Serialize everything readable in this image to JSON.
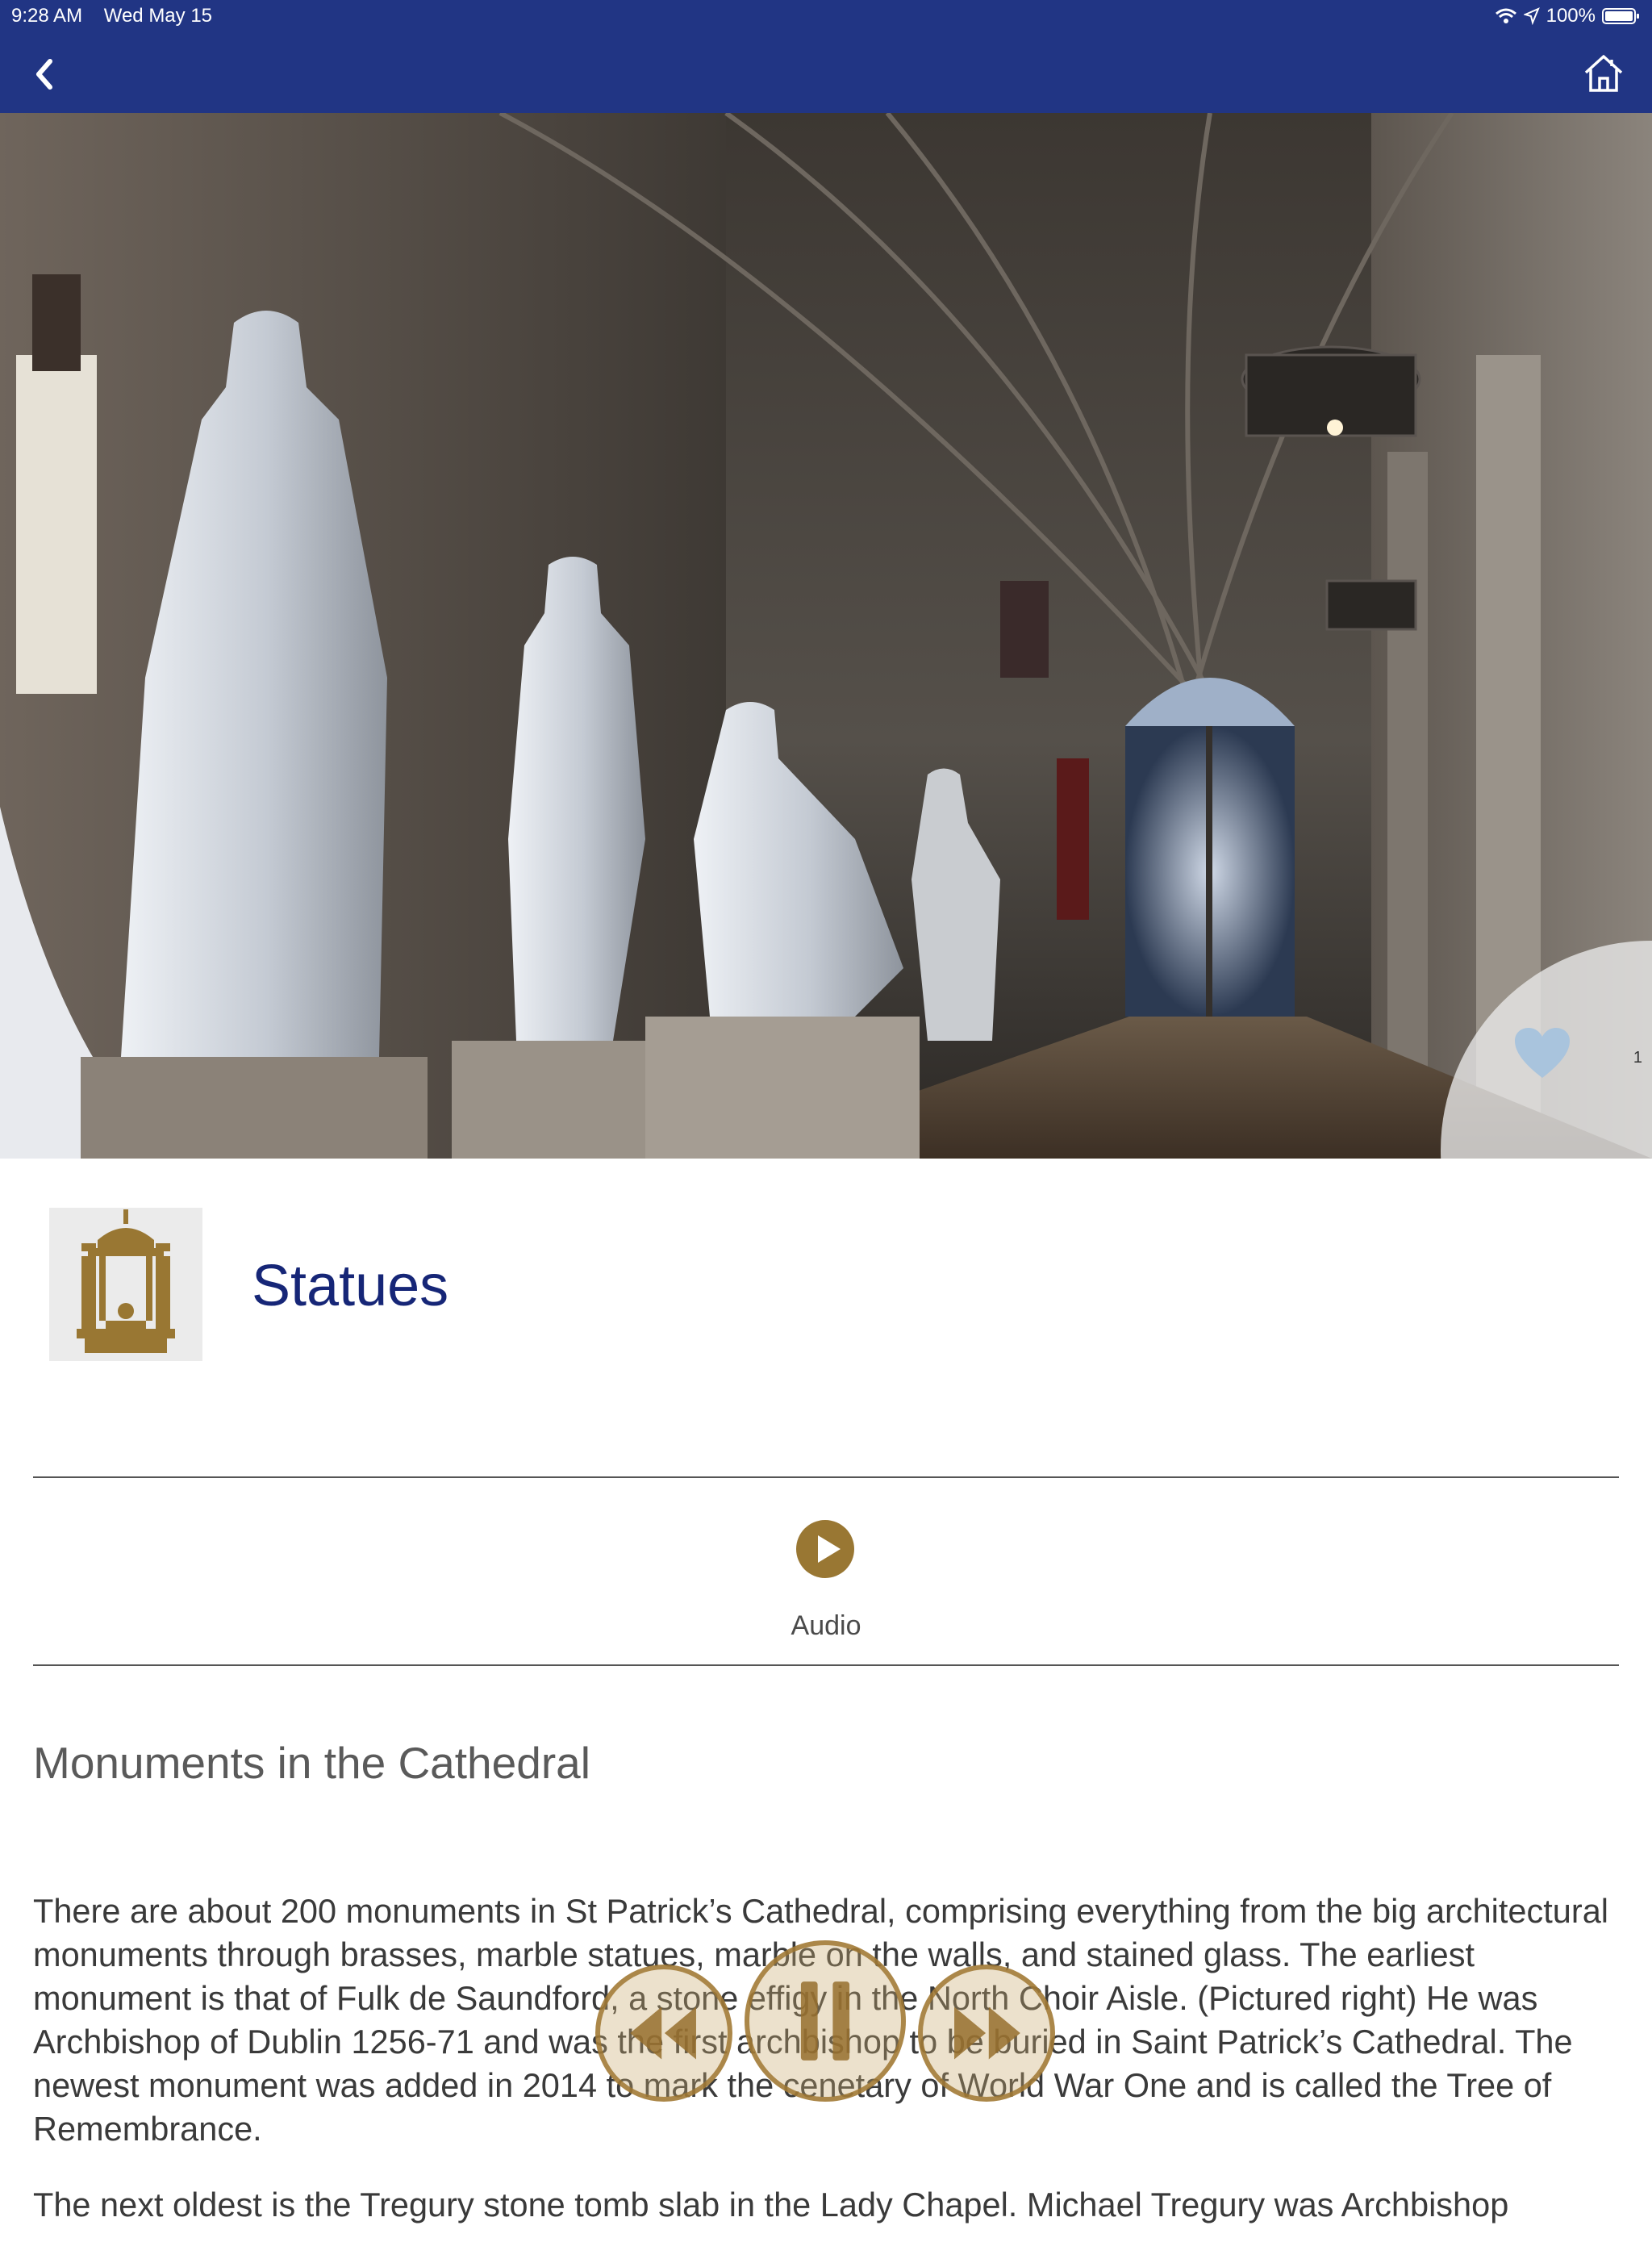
{
  "status_bar": {
    "time": "9:28 AM",
    "date": "Wed May 15",
    "battery": "100%",
    "icons": [
      "wifi-icon",
      "location-icon",
      "battery-icon"
    ]
  },
  "nav": {
    "back_icon": "chevron-left-icon",
    "home_icon": "home-icon",
    "background_color": "#213584"
  },
  "hero": {
    "image": "cathedral-statues-photo",
    "favourites_count": "1",
    "heart_icon": "heart-icon"
  },
  "header": {
    "title": "Statues",
    "icon": "monument-icon",
    "accent_color": "#997733",
    "title_color": "#162677"
  },
  "audio": {
    "label": "Audio",
    "icon": "play-circle-icon"
  },
  "content": {
    "heading": "Monuments in the Cathedral",
    "paragraphs": [
      "There are about 200 monuments in St Patrick’s Cathedral, comprising everything from the big architectural monuments through brasses, marble statues, marble on the walls, and stained glass. The earliest monument is that of Fulk de Saundford, a stone effigy in the North Choir Aisle. (Pictured right) He was Archbishop of Dublin 1256-71 and was the first archbishop to be buried in Saint Patrick’s Cathedral. The newest monument was added in 2014 to mark the cenetary of World War One and is called the Tree of Remembrance.",
      "The next oldest is the Tregury stone tomb slab in the Lady Chapel. Michael Tregury was Archbishop"
    ]
  },
  "player": {
    "rewind_icon": "rewind-icon",
    "pause_icon": "pause-icon",
    "forward_icon": "fast-forward-icon"
  }
}
